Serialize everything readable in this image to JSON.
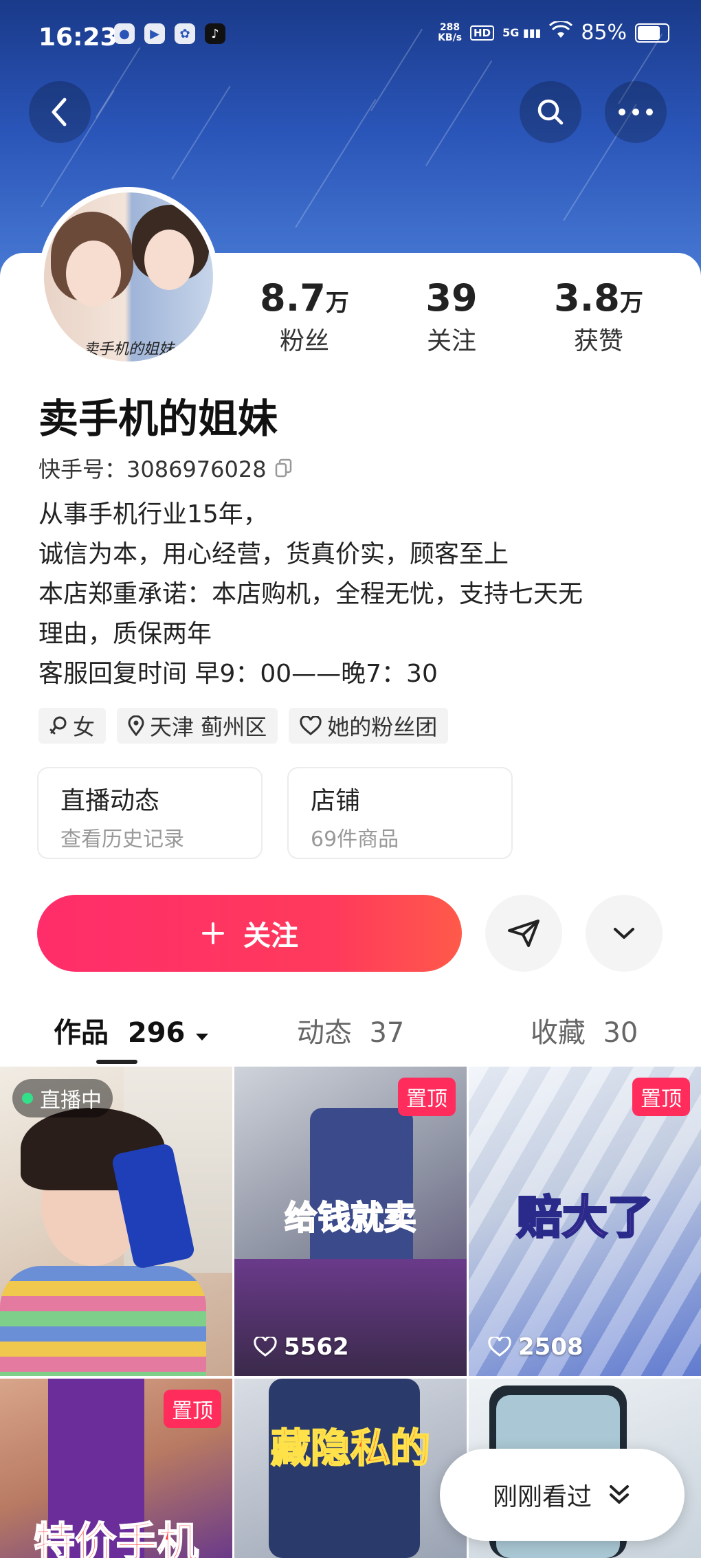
{
  "statusbar": {
    "time": "16:23",
    "net_speed_value": "288",
    "net_speed_unit": "KB/s",
    "hd": "HD",
    "network": "5G",
    "battery": "85%",
    "battery_level": 0.85,
    "app_icons": [
      "baidu-icon",
      "video-icon",
      "pinwheel-icon",
      "douyin-icon"
    ]
  },
  "header": {
    "back_icon": "back-arrow-icon",
    "search_icon": "search-icon",
    "more_icon": "more-icon"
  },
  "profile": {
    "avatar_caption": "卖手机的姐妹",
    "stats": [
      {
        "num": "8.7",
        "unit": "万",
        "label": "粉丝"
      },
      {
        "num": "39",
        "unit": "",
        "label": "关注"
      },
      {
        "num": "3.8",
        "unit": "万",
        "label": "获赞"
      }
    ],
    "name": "卖手机的姐妹",
    "kuaishou_id": "快手号：3086976028",
    "bio": [
      "从事手机行业15年，",
      "诚信为本，用心经营，货真价实，顾客至上",
      "本店郑重承诺：本店购机，全程无忧，支持七天无",
      "理由，质保两年",
      "客服回复时间 早9：00——晚7：30"
    ],
    "tags": [
      {
        "icon": "gender-female-icon",
        "label": "女"
      },
      {
        "icon": "location-icon",
        "label": "天津 蓟州区"
      },
      {
        "icon": "fan-club-icon",
        "label": "她的粉丝团"
      }
    ]
  },
  "entries": [
    {
      "title": "直播动态",
      "subtitle": "查看历史记录"
    },
    {
      "title": "店铺",
      "subtitle": "69件商品"
    }
  ],
  "actions": {
    "follow_label": "关注",
    "share_icon": "send-icon",
    "more_icon": "chevron-down-icon"
  },
  "tabs": [
    {
      "label": "作品",
      "count": "296"
    },
    {
      "label": "动态",
      "count": "37"
    },
    {
      "label": "收藏",
      "count": "30"
    }
  ],
  "grid": [
    {
      "live_label": "直播中"
    },
    {
      "pin": "置顶",
      "overlay": "给钱就卖",
      "likes": "5562"
    },
    {
      "pin": "置顶",
      "overlay": "赔大了",
      "likes": "2508"
    },
    {
      "pin": "置顶",
      "overlay": "特价手机"
    },
    {
      "overlay": "藏隐私的"
    },
    {}
  ],
  "recent_button": "刚刚看过",
  "colors": {
    "accent": "#ff2d6a",
    "hero_blue": "#2a55b8",
    "live_green": "#33e08a"
  }
}
